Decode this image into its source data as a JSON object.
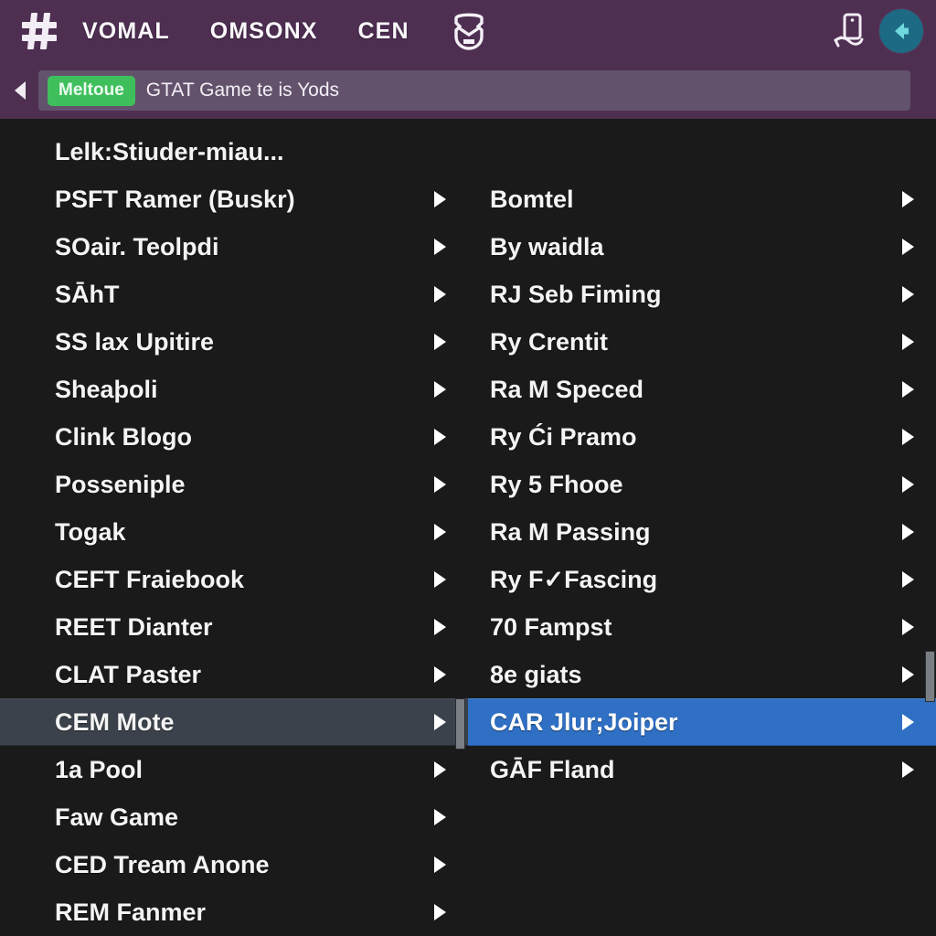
{
  "header": {
    "logo_icon": "hash-logo-icon",
    "nav_items": [
      {
        "label": "VOMAL"
      },
      {
        "label": "OMSONX"
      },
      {
        "label": "CEN"
      }
    ],
    "mask_icon": "mask-helmet-icon",
    "phone_icon": "mobile-phone-icon",
    "round_button_icon": "share-back-arrow-icon",
    "background_color": "#4e2f52",
    "accent_color": "#1c6a83"
  },
  "breadcrumb": {
    "back_icon": "back-caret-icon",
    "badge": "Meltoue",
    "badge_color": "#3fbf5c",
    "text": "GTAT Game te is Yods",
    "field_color": "#62526c"
  },
  "menu": {
    "background_color": "#1a1a1a",
    "selected_grey_color": "#3b424b",
    "selected_blue_color": "#2f6fc4",
    "left_column": {
      "title": "Lelk:Stiuder-miau...",
      "items": [
        {
          "label": "PSFT Ramer (Buskr)",
          "selected": false
        },
        {
          "label": "SOair. Teolpdi",
          "selected": false
        },
        {
          "label": "SĀhT",
          "selected": false
        },
        {
          "label": "SS lax Upitire",
          "selected": false
        },
        {
          "label": "Sheaþoli",
          "selected": false
        },
        {
          "label": "Clink Blogo",
          "selected": false
        },
        {
          "label": "Posseniple",
          "selected": false
        },
        {
          "label": "Togak",
          "selected": false
        },
        {
          "label": "CEFT Fraiebook",
          "selected": false
        },
        {
          "label": "REET Dianter",
          "selected": false
        },
        {
          "label": "CLAT Paster",
          "selected": false
        },
        {
          "label": "CEM Mote",
          "selected": "grey"
        },
        {
          "label": "1a Pool",
          "selected": false
        },
        {
          "label": "Faw Game",
          "selected": false
        },
        {
          "label": "CED Tream Anone",
          "selected": false
        },
        {
          "label": "REM Fanmer",
          "selected": false
        }
      ]
    },
    "right_column": {
      "items": [
        {
          "label": "Bomtel",
          "selected": false
        },
        {
          "label": "By waidla",
          "selected": false
        },
        {
          "label": "RJ Seb Fiming",
          "selected": false
        },
        {
          "label": "Ry Crentit",
          "selected": false
        },
        {
          "label": "Ra M Speced",
          "selected": false
        },
        {
          "label": "Ry Ći Pramo",
          "selected": false
        },
        {
          "label": "Ry 5 Fhooe",
          "selected": false
        },
        {
          "label": "Ra M Passing",
          "selected": false
        },
        {
          "label": "Ry F✓Fascing",
          "selected": false
        },
        {
          "label": "70 Fampst",
          "selected": false
        },
        {
          "label": "8e giats",
          "selected": false
        },
        {
          "label": "CAR Jlur;Joiper",
          "selected": "blue"
        },
        {
          "label": "GĀF Fland",
          "selected": false
        }
      ]
    }
  }
}
